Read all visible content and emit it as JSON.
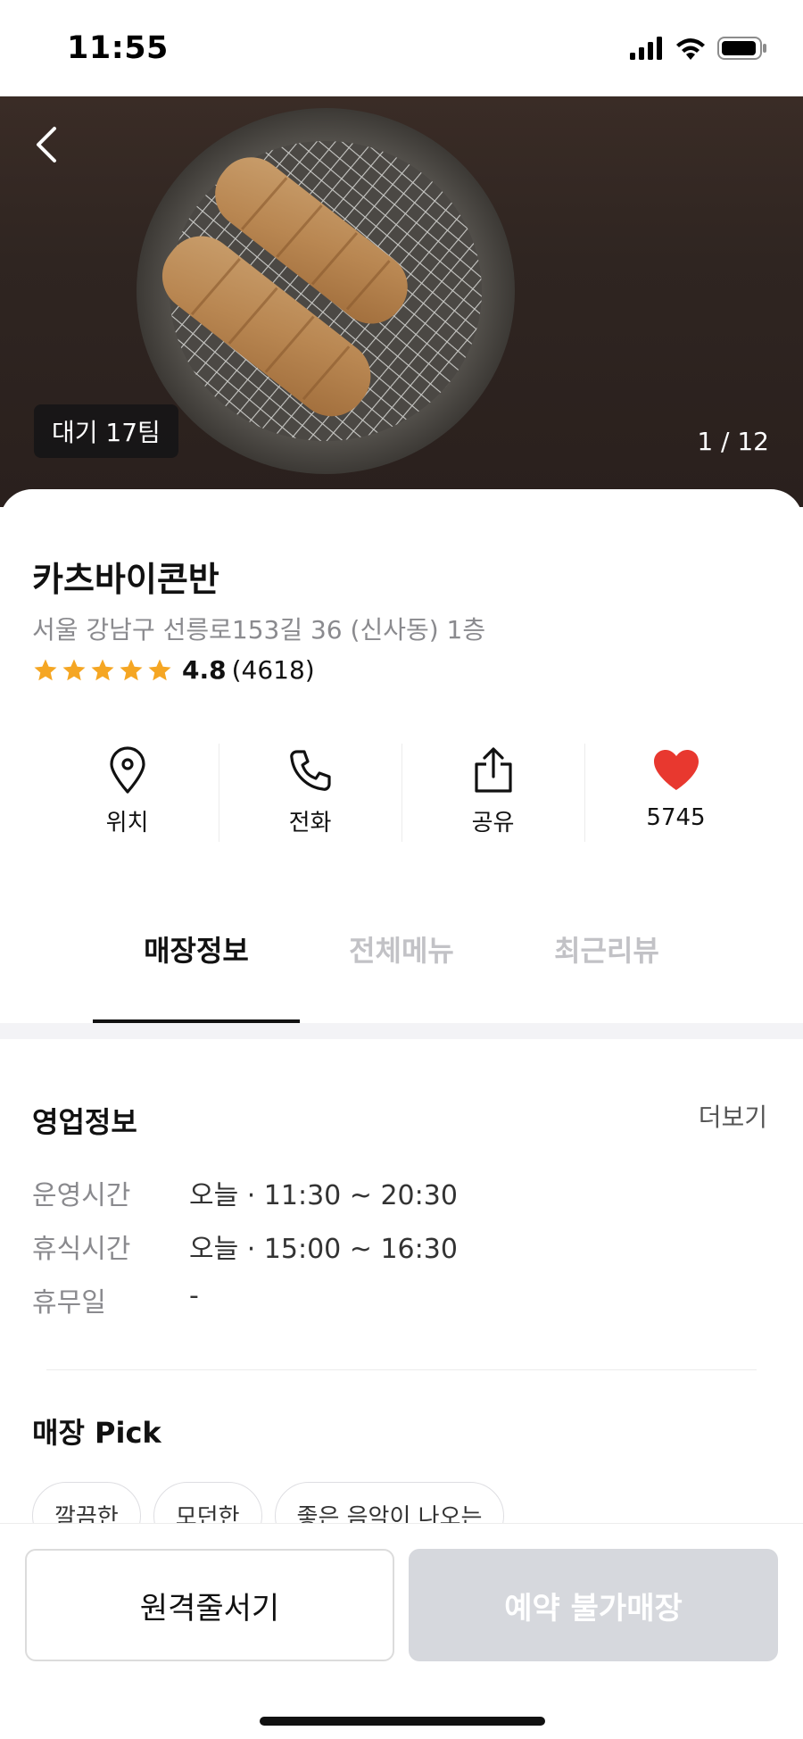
{
  "status_bar": {
    "time": "11:55"
  },
  "hero": {
    "wait_badge": "대기 17팀",
    "page_counter": "1 / 12"
  },
  "store": {
    "name": "카츠바이콘반",
    "address": "서울 강남구 선릉로153길 36 (신사동) 1층",
    "rating": "4.8",
    "review_count": "(4618)",
    "stars": 5
  },
  "actions": [
    {
      "label": "위치",
      "icon": "location-pin-icon"
    },
    {
      "label": "전화",
      "icon": "phone-icon"
    },
    {
      "label": "공유",
      "icon": "share-icon"
    },
    {
      "label": "5745",
      "icon": "heart-icon"
    }
  ],
  "tabs": [
    {
      "label": "매장정보",
      "active": true
    },
    {
      "label": "전체메뉴",
      "active": false
    },
    {
      "label": "최근리뷰",
      "active": false
    }
  ],
  "business_info": {
    "title": "영업정보",
    "more": "더보기",
    "rows": [
      {
        "label": "운영시간",
        "value": "오늘 · 11:30 ~ 20:30"
      },
      {
        "label": "휴식시간",
        "value": "오늘 · 15:00 ~ 16:30"
      },
      {
        "label": "휴무일",
        "value": "-"
      }
    ]
  },
  "store_pick": {
    "title": "매장 Pick",
    "chips": [
      "깔끔한",
      "모던한",
      "좋은 음악이 나오는"
    ]
  },
  "bottom": {
    "queue_button": "원격줄서기",
    "reserve_button": "예약 불가매장"
  },
  "colors": {
    "star": "#F5A623",
    "heart": "#E8382F",
    "disabled_button": "#D6D8DD"
  }
}
